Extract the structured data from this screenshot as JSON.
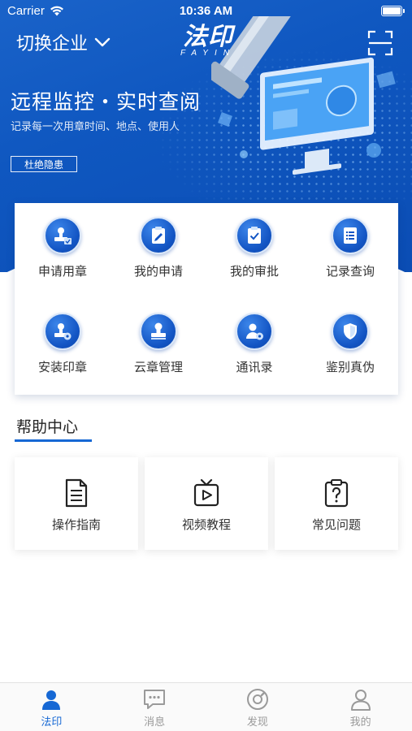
{
  "status_bar": {
    "carrier": "Carrier",
    "time": "10:36 AM"
  },
  "header": {
    "switch_company": "切换企业",
    "logo_main": "法印",
    "logo_sub": "FAYIN"
  },
  "banner": {
    "title": "远程监控・实时查阅",
    "subtitle": "记录每一次用章时间、地点、使用人",
    "tag": "杜绝隐患"
  },
  "functions": [
    {
      "label": "申请用章",
      "icon": "stamp-apply-icon"
    },
    {
      "label": "我的申请",
      "icon": "edit-document-icon"
    },
    {
      "label": "我的审批",
      "icon": "clipboard-check-icon"
    },
    {
      "label": "记录查询",
      "icon": "list-document-icon"
    },
    {
      "label": "安装印章",
      "icon": "stamp-settings-icon"
    },
    {
      "label": "云章管理",
      "icon": "stamp-icon"
    },
    {
      "label": "通讯录",
      "icon": "contacts-icon"
    },
    {
      "label": "鉴别真伪",
      "icon": "shield-icon"
    }
  ],
  "help_center": {
    "title": "帮助中心",
    "items": [
      {
        "label": "操作指南",
        "icon": "document-icon"
      },
      {
        "label": "视频教程",
        "icon": "video-tv-icon"
      },
      {
        "label": "常见问题",
        "icon": "question-clipboard-icon"
      }
    ]
  },
  "tab_bar": {
    "tabs": [
      {
        "label": "法印",
        "icon": "person-icon",
        "active": true
      },
      {
        "label": "消息",
        "icon": "chat-bubble-icon",
        "active": false
      },
      {
        "label": "发现",
        "icon": "compass-icon",
        "active": false
      },
      {
        "label": "我的",
        "icon": "profile-icon",
        "active": false
      }
    ]
  },
  "colors": {
    "primary": "#1668d4",
    "banner": "#0f57c0",
    "tab_inactive": "#9a9a9a"
  }
}
